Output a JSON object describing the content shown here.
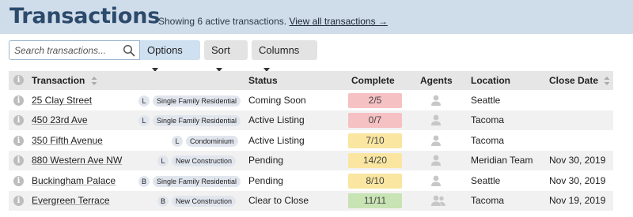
{
  "header": {
    "title": "Transactions",
    "subtitle": "Showing 6 active transactions.",
    "view_all_link": "View all transactions →"
  },
  "toolbar": {
    "search_placeholder": "Search transactions...",
    "options_label": "Options",
    "sort_label": "Sort",
    "columns_label": "Columns"
  },
  "table": {
    "columns": [
      "Transaction",
      "Status",
      "Complete",
      "Agents",
      "Location",
      "Close Date"
    ],
    "rows": [
      {
        "name": "25 Clay Street",
        "side": "L",
        "type": "Single Family Residential",
        "status": "Coming Soon",
        "complete": "2/5",
        "complete_color": "#f6c1c3",
        "location": "Seattle",
        "close_date": "",
        "agents": "single"
      },
      {
        "name": "450 23rd Ave",
        "side": "L",
        "type": "Single Family Residential",
        "status": "Active Listing",
        "complete": "0/7",
        "complete_color": "#f6c1c3",
        "location": "Tacoma",
        "close_date": "",
        "agents": "single"
      },
      {
        "name": "350 Fifth Avenue",
        "side": "L",
        "type": "Condominium",
        "status": "Active Listing",
        "complete": "7/10",
        "complete_color": "#fae6a1",
        "location": "Tacoma",
        "close_date": "",
        "agents": "single"
      },
      {
        "name": "880 Western Ave NW",
        "side": "L",
        "type": "New Construction",
        "status": "Pending",
        "complete": "14/20",
        "complete_color": "#fae6a1",
        "location": "Meridian Team",
        "close_date": "Nov 30, 2019",
        "agents": "single"
      },
      {
        "name": "Buckingham Palace",
        "side": "B",
        "type": "Single Family Residential",
        "status": "Pending",
        "complete": "8/10",
        "complete_color": "#fae6a1",
        "location": "Seattle",
        "close_date": "Nov 30, 2019",
        "agents": "single"
      },
      {
        "name": "Evergreen Terrace",
        "side": "B",
        "type": "New Construction",
        "status": "Clear to Close",
        "complete": "11/11",
        "complete_color": "#c8e3b4",
        "location": "Tacoma",
        "close_date": "Nov 19, 2019",
        "agents": "group"
      }
    ]
  },
  "colors": {
    "header_bg": "#cfdcea",
    "title": "#2c4a6b",
    "options_bg": "#cfe0f0"
  }
}
